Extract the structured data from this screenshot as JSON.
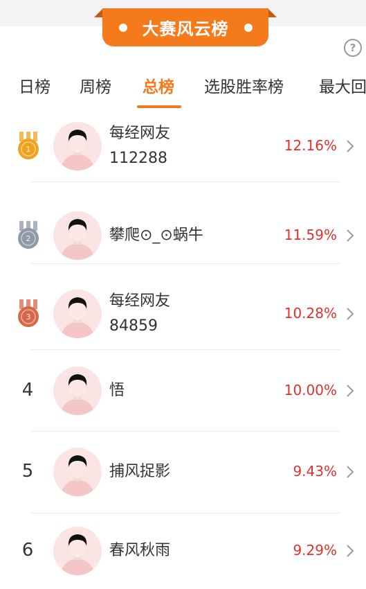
{
  "banner": {
    "title": "大赛风云榜"
  },
  "help": {
    "glyph": "?"
  },
  "tabs": [
    {
      "label": "日榜"
    },
    {
      "label": "周榜"
    },
    {
      "label": "总榜"
    },
    {
      "label": "选股胜率榜"
    },
    {
      "label": "最大回"
    }
  ],
  "ranks": [
    {
      "rank": "1",
      "medal": "gold-medal-icon",
      "name_line1": "每经网友",
      "name_line2": "112288",
      "rate": "12.16%"
    },
    {
      "rank": "2",
      "medal": "silver-medal-icon",
      "name_line1": "攀爬⊙_⊙蜗牛",
      "name_line2": "",
      "rate": "11.59%"
    },
    {
      "rank": "3",
      "medal": "bronze-medal-icon",
      "name_line1": "每经网友",
      "name_line2": "84859",
      "rate": "10.28%"
    },
    {
      "rank": "4",
      "medal": "",
      "name_line1": "悟",
      "name_line2": "",
      "rate": "10.00%"
    },
    {
      "rank": "5",
      "medal": "",
      "name_line1": "捕风捉影",
      "name_line2": "",
      "rate": "9.43%"
    },
    {
      "rank": "6",
      "medal": "",
      "name_line1": "春风秋雨",
      "name_line2": "",
      "rate": "9.29%"
    }
  ],
  "colors": {
    "accent": "#f47a1c",
    "rate": "#e0312d",
    "gold": "#f0a21e",
    "silver": "#8f9aa6",
    "bronze": "#d8674a"
  }
}
